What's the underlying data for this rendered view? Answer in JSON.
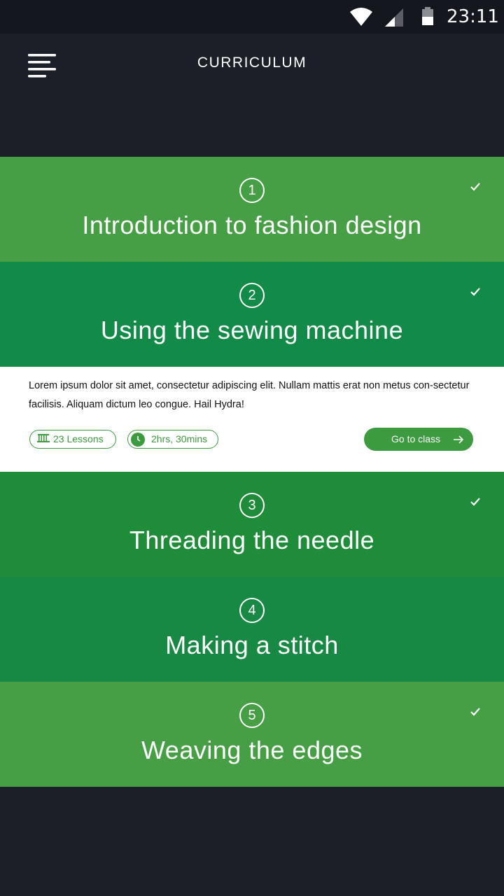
{
  "status_bar": {
    "time": "23:11",
    "icons": [
      "wifi-icon",
      "signal-icon",
      "battery-icon"
    ]
  },
  "header": {
    "title": "CURRICULUM",
    "menu_icon": "menu-icon"
  },
  "modules": [
    {
      "number": "1",
      "title": "Introduction to fashion design",
      "completed": true,
      "color": "#469f44"
    },
    {
      "number": "2",
      "title": "Using the sewing machine",
      "completed": true,
      "color": "#138b48",
      "expanded": true
    },
    {
      "number": "3",
      "title": "Threading the needle",
      "completed": true,
      "color": "#1f8c3a"
    },
    {
      "number": "4",
      "title": "Making a stitch",
      "completed": false,
      "color": "#178944"
    },
    {
      "number": "5",
      "title": "Weaving the edges",
      "completed": true,
      "color": "#469f44"
    }
  ],
  "details": {
    "description": "Lorem ipsum dolor sit amet, consectetur adipiscing elit. Nullam mattis erat non metus con-sectetur facilisis. Aliquam dictum leo congue. Hail Hydra!",
    "lessons": "23 Lessons",
    "lessons_icon": "lessons-icon",
    "duration": "2hrs, 30mins",
    "duration_icon": "clock-icon",
    "button_label": "Go to class",
    "button_icon": "arrow-right-icon"
  },
  "colors": {
    "background": "#1b1f27",
    "status_bar": "#14181e",
    "accent": "#3c9b3f"
  }
}
